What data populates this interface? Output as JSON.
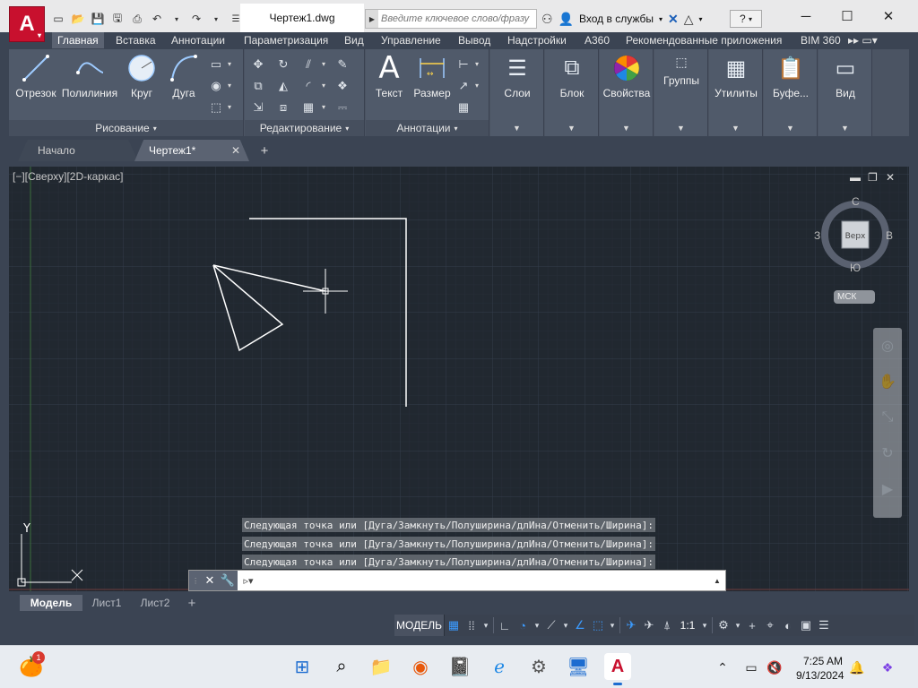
{
  "titlebar": {
    "document": "Чертеж1.dwg",
    "search_placeholder": "Введите ключевое слово/фразу",
    "signin": "Вход в службы",
    "help": "?",
    "minimize": "─",
    "maximize": "☐",
    "close": "✕"
  },
  "ribbon_tabs": [
    "Главная",
    "Вставка",
    "Аннотации",
    "Параметризация",
    "Вид",
    "Управление",
    "Вывод",
    "Надстройки",
    "A360",
    "Рекомендованные приложения",
    "BIM 360"
  ],
  "ribbon": {
    "draw": {
      "title": "Рисование",
      "line": "Отрезок",
      "polyline": "Полилиния",
      "circle": "Круг",
      "arc": "Дуга"
    },
    "modify": {
      "title": "Редактирование"
    },
    "annotation": {
      "title": "Аннотации",
      "text": "Текст",
      "dimension": "Размер"
    },
    "layers": "Слои",
    "block": "Блок",
    "properties": "Свойства",
    "groups": "Группы",
    "utilities": "Утилиты",
    "clipboard": "Буфе...",
    "view": "Вид"
  },
  "file_tabs": {
    "start": "Начало",
    "doc": "Чертеж1*",
    "add": "+"
  },
  "viewport": {
    "label": "[−][Сверху][2D-каркас]",
    "compass": {
      "n": "С",
      "s": "Ю",
      "e": "В",
      "w": "З",
      "cube": "Верх"
    },
    "wcs": "МСК",
    "ucs_y": "Y"
  },
  "command_history": [
    "Следующая точка или [Дуга/Замкнуть/Полуширина/длИна/Отменить/Ширина]:",
    "Следующая точка или [Дуга/Замкнуть/Полуширина/длИна/Отменить/Ширина]:",
    "Следующая точка или [Дуга/Замкнуть/Полуширина/длИна/Отменить/Ширина]:"
  ],
  "layout_tabs": {
    "model": "Модель",
    "sheet1": "Лист1",
    "sheet2": "Лист2",
    "add": "+"
  },
  "status": {
    "model": "МОДЕЛЬ",
    "scale": "1:1"
  },
  "taskbar": {
    "notification_count": "1",
    "time": "7:25 AM",
    "date": "9/13/2024"
  },
  "colors": {
    "accent": "#c8102e",
    "viewport_bg": "#212830",
    "ribbon_bg": "#505a6a",
    "status_on": "#3b9bff"
  }
}
